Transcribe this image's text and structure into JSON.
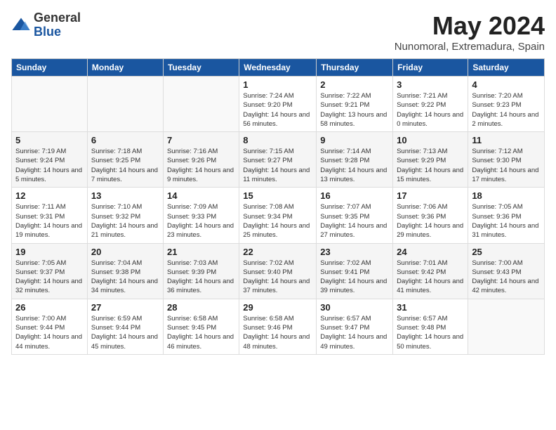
{
  "logo": {
    "general": "General",
    "blue": "Blue"
  },
  "title": "May 2024",
  "location": "Nunomoral, Extremadura, Spain",
  "headers": [
    "Sunday",
    "Monday",
    "Tuesday",
    "Wednesday",
    "Thursday",
    "Friday",
    "Saturday"
  ],
  "weeks": [
    [
      {
        "date": "",
        "info": ""
      },
      {
        "date": "",
        "info": ""
      },
      {
        "date": "",
        "info": ""
      },
      {
        "date": "1",
        "info": "Sunrise: 7:24 AM\nSunset: 9:20 PM\nDaylight: 14 hours and 56 minutes."
      },
      {
        "date": "2",
        "info": "Sunrise: 7:22 AM\nSunset: 9:21 PM\nDaylight: 13 hours and 58 minutes."
      },
      {
        "date": "3",
        "info": "Sunrise: 7:21 AM\nSunset: 9:22 PM\nDaylight: 14 hours and 0 minutes."
      },
      {
        "date": "4",
        "info": "Sunrise: 7:20 AM\nSunset: 9:23 PM\nDaylight: 14 hours and 2 minutes."
      }
    ],
    [
      {
        "date": "5",
        "info": "Sunrise: 7:19 AM\nSunset: 9:24 PM\nDaylight: 14 hours and 5 minutes."
      },
      {
        "date": "6",
        "info": "Sunrise: 7:18 AM\nSunset: 9:25 PM\nDaylight: 14 hours and 7 minutes."
      },
      {
        "date": "7",
        "info": "Sunrise: 7:16 AM\nSunset: 9:26 PM\nDaylight: 14 hours and 9 minutes."
      },
      {
        "date": "8",
        "info": "Sunrise: 7:15 AM\nSunset: 9:27 PM\nDaylight: 14 hours and 11 minutes."
      },
      {
        "date": "9",
        "info": "Sunrise: 7:14 AM\nSunset: 9:28 PM\nDaylight: 14 hours and 13 minutes."
      },
      {
        "date": "10",
        "info": "Sunrise: 7:13 AM\nSunset: 9:29 PM\nDaylight: 14 hours and 15 minutes."
      },
      {
        "date": "11",
        "info": "Sunrise: 7:12 AM\nSunset: 9:30 PM\nDaylight: 14 hours and 17 minutes."
      }
    ],
    [
      {
        "date": "12",
        "info": "Sunrise: 7:11 AM\nSunset: 9:31 PM\nDaylight: 14 hours and 19 minutes."
      },
      {
        "date": "13",
        "info": "Sunrise: 7:10 AM\nSunset: 9:32 PM\nDaylight: 14 hours and 21 minutes."
      },
      {
        "date": "14",
        "info": "Sunrise: 7:09 AM\nSunset: 9:33 PM\nDaylight: 14 hours and 23 minutes."
      },
      {
        "date": "15",
        "info": "Sunrise: 7:08 AM\nSunset: 9:34 PM\nDaylight: 14 hours and 25 minutes."
      },
      {
        "date": "16",
        "info": "Sunrise: 7:07 AM\nSunset: 9:35 PM\nDaylight: 14 hours and 27 minutes."
      },
      {
        "date": "17",
        "info": "Sunrise: 7:06 AM\nSunset: 9:36 PM\nDaylight: 14 hours and 29 minutes."
      },
      {
        "date": "18",
        "info": "Sunrise: 7:05 AM\nSunset: 9:36 PM\nDaylight: 14 hours and 31 minutes."
      }
    ],
    [
      {
        "date": "19",
        "info": "Sunrise: 7:05 AM\nSunset: 9:37 PM\nDaylight: 14 hours and 32 minutes."
      },
      {
        "date": "20",
        "info": "Sunrise: 7:04 AM\nSunset: 9:38 PM\nDaylight: 14 hours and 34 minutes."
      },
      {
        "date": "21",
        "info": "Sunrise: 7:03 AM\nSunset: 9:39 PM\nDaylight: 14 hours and 36 minutes."
      },
      {
        "date": "22",
        "info": "Sunrise: 7:02 AM\nSunset: 9:40 PM\nDaylight: 14 hours and 37 minutes."
      },
      {
        "date": "23",
        "info": "Sunrise: 7:02 AM\nSunset: 9:41 PM\nDaylight: 14 hours and 39 minutes."
      },
      {
        "date": "24",
        "info": "Sunrise: 7:01 AM\nSunset: 9:42 PM\nDaylight: 14 hours and 41 minutes."
      },
      {
        "date": "25",
        "info": "Sunrise: 7:00 AM\nSunset: 9:43 PM\nDaylight: 14 hours and 42 minutes."
      }
    ],
    [
      {
        "date": "26",
        "info": "Sunrise: 7:00 AM\nSunset: 9:44 PM\nDaylight: 14 hours and 44 minutes."
      },
      {
        "date": "27",
        "info": "Sunrise: 6:59 AM\nSunset: 9:44 PM\nDaylight: 14 hours and 45 minutes."
      },
      {
        "date": "28",
        "info": "Sunrise: 6:58 AM\nSunset: 9:45 PM\nDaylight: 14 hours and 46 minutes."
      },
      {
        "date": "29",
        "info": "Sunrise: 6:58 AM\nSunset: 9:46 PM\nDaylight: 14 hours and 48 minutes."
      },
      {
        "date": "30",
        "info": "Sunrise: 6:57 AM\nSunset: 9:47 PM\nDaylight: 14 hours and 49 minutes."
      },
      {
        "date": "31",
        "info": "Sunrise: 6:57 AM\nSunset: 9:48 PM\nDaylight: 14 hours and 50 minutes."
      },
      {
        "date": "",
        "info": ""
      }
    ]
  ]
}
